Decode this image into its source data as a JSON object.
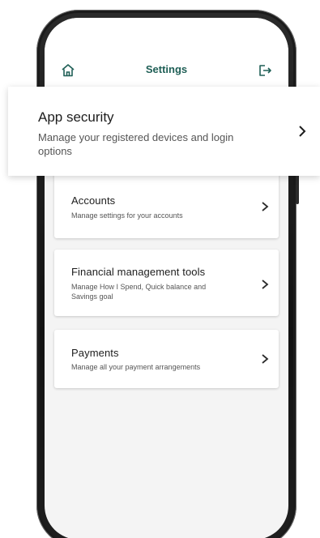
{
  "header": {
    "title": "Settings",
    "home_icon": "home-icon",
    "logout_icon": "logout-icon",
    "accent_color": "#1f5f56"
  },
  "highlight": {
    "title": "App security",
    "description": "Manage your registered devices and login options"
  },
  "cards": [
    {
      "title": "Accounts",
      "description": "Manage settings for your accounts"
    },
    {
      "title": "Financial management tools",
      "description": "Manage How I Spend, Quick balance and Savings goal"
    },
    {
      "title": "Payments",
      "description": "Manage all your payment arrangements"
    }
  ]
}
